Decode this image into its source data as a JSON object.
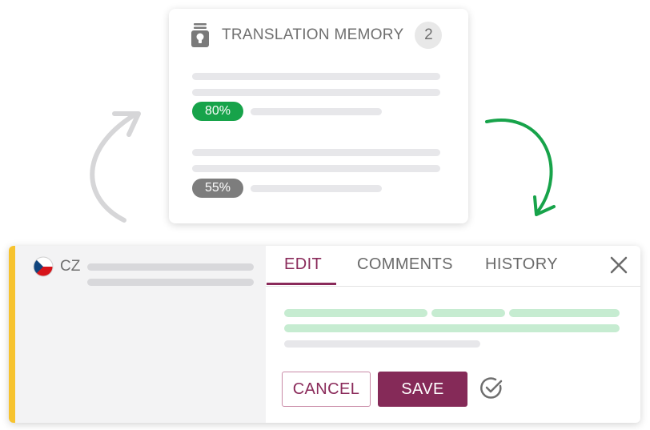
{
  "tm_card": {
    "title": "TRANSLATION MEMORY",
    "count": "2",
    "matches": [
      {
        "percent": "80%",
        "color": "#17a34a"
      },
      {
        "percent": "55%",
        "color": "#7d7d7d"
      }
    ]
  },
  "editor": {
    "language": "CZ",
    "flag": "czech-flag",
    "tabs": [
      "EDIT",
      "COMMENTS",
      "HISTORY"
    ],
    "active_tab": "EDIT",
    "cancel_label": "CANCEL",
    "save_label": "SAVE"
  },
  "colors": {
    "accent_yellow": "#f7c32e",
    "brand": "#852a58",
    "match_green": "#17a34a",
    "suggestion_green": "#c6ecd1"
  },
  "icons": [
    "tm-jar-icon",
    "close-icon",
    "check-circle-icon",
    "curved-arrow-gray",
    "curved-arrow-green"
  ]
}
